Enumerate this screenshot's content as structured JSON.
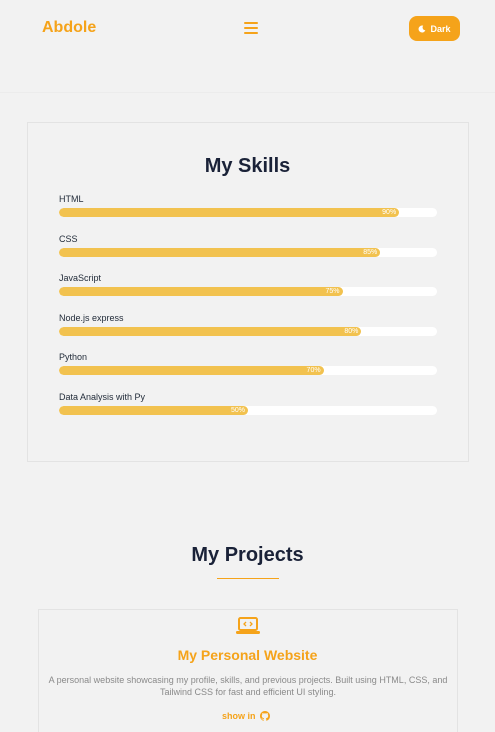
{
  "nav": {
    "brand": "Abdole",
    "theme_button_label": "Dark",
    "menu_icon": "hamburger-icon",
    "theme_icon": "moon-icon"
  },
  "skills": {
    "title": "My Skills",
    "items": [
      {
        "name": "HTML",
        "percent": 90,
        "label": "90%"
      },
      {
        "name": "CSS",
        "percent": 85,
        "label": "85%"
      },
      {
        "name": "JavaScript",
        "percent": 75,
        "label": "75%"
      },
      {
        "name": "Node.js express",
        "percent": 80,
        "label": "80%"
      },
      {
        "name": "Python",
        "percent": 70,
        "label": "70%"
      },
      {
        "name": "Data Analysis with Py",
        "percent": 50,
        "label": "50%"
      }
    ]
  },
  "projects": {
    "title": "My Projects",
    "items": [
      {
        "icon": "laptop-code-icon",
        "name": "My Personal Website",
        "description": "A personal website showcasing my profile, skills, and previous projects. Built using HTML, CSS, and Tailwind CSS for fast and efficient UI styling.",
        "link_label": "show in",
        "link_icon": "github-icon"
      }
    ]
  },
  "colors": {
    "accent": "#f5a31a",
    "bar_fill": "#f2c24f",
    "heading": "#1a2238",
    "background": "#f2f2f2"
  }
}
